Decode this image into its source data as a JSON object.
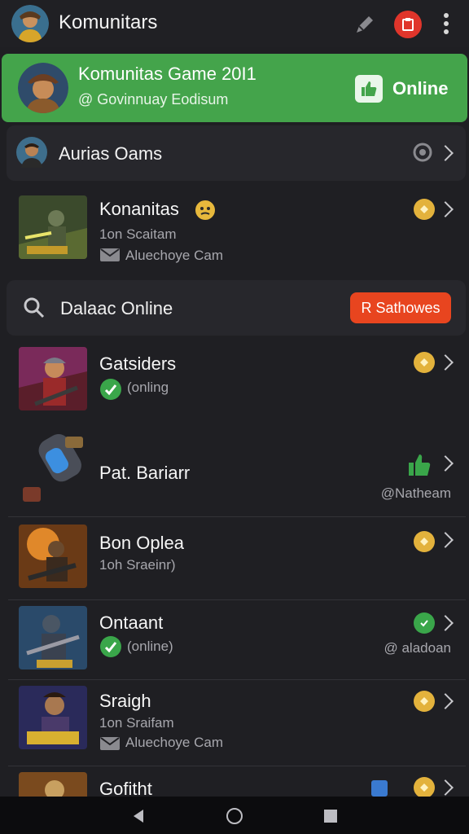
{
  "topbar": {
    "title": "Komunitars",
    "icons": [
      "pencil-icon",
      "red-box-icon",
      "more-icon"
    ]
  },
  "banner": {
    "title": "Komunitas Game 20I1",
    "subtitle": "@ Govinnuay Eodisum",
    "online_label": "Online"
  },
  "pinned": {
    "name": "Aurias Oams"
  },
  "items": [
    {
      "name": "Konanitas",
      "sub1": "1on Scaitam",
      "sub2": "Aluechoye Cam"
    },
    {
      "name": "Gatsiders",
      "sub1": "(onling"
    },
    {
      "name": "Pat. Bariarr",
      "tag": "@Natheam"
    },
    {
      "name": "Bon Oplea",
      "sub1": "1oh Sraeinr)"
    },
    {
      "name": "Ontaant",
      "sub1": "(online)",
      "tag": "@ aladoan"
    },
    {
      "name": "Sraigh",
      "sub1": "1on Sraifam",
      "sub2": "Aluechoye Cam"
    },
    {
      "name": "Gofitht"
    }
  ],
  "search": {
    "label": "Dalaac Online",
    "sort_label": "R Sathowes"
  },
  "colors": {
    "accent_green": "#44a44b",
    "accent_red": "#e0352b",
    "accent_orange": "#e8451f",
    "coin": "#e3b23c"
  }
}
